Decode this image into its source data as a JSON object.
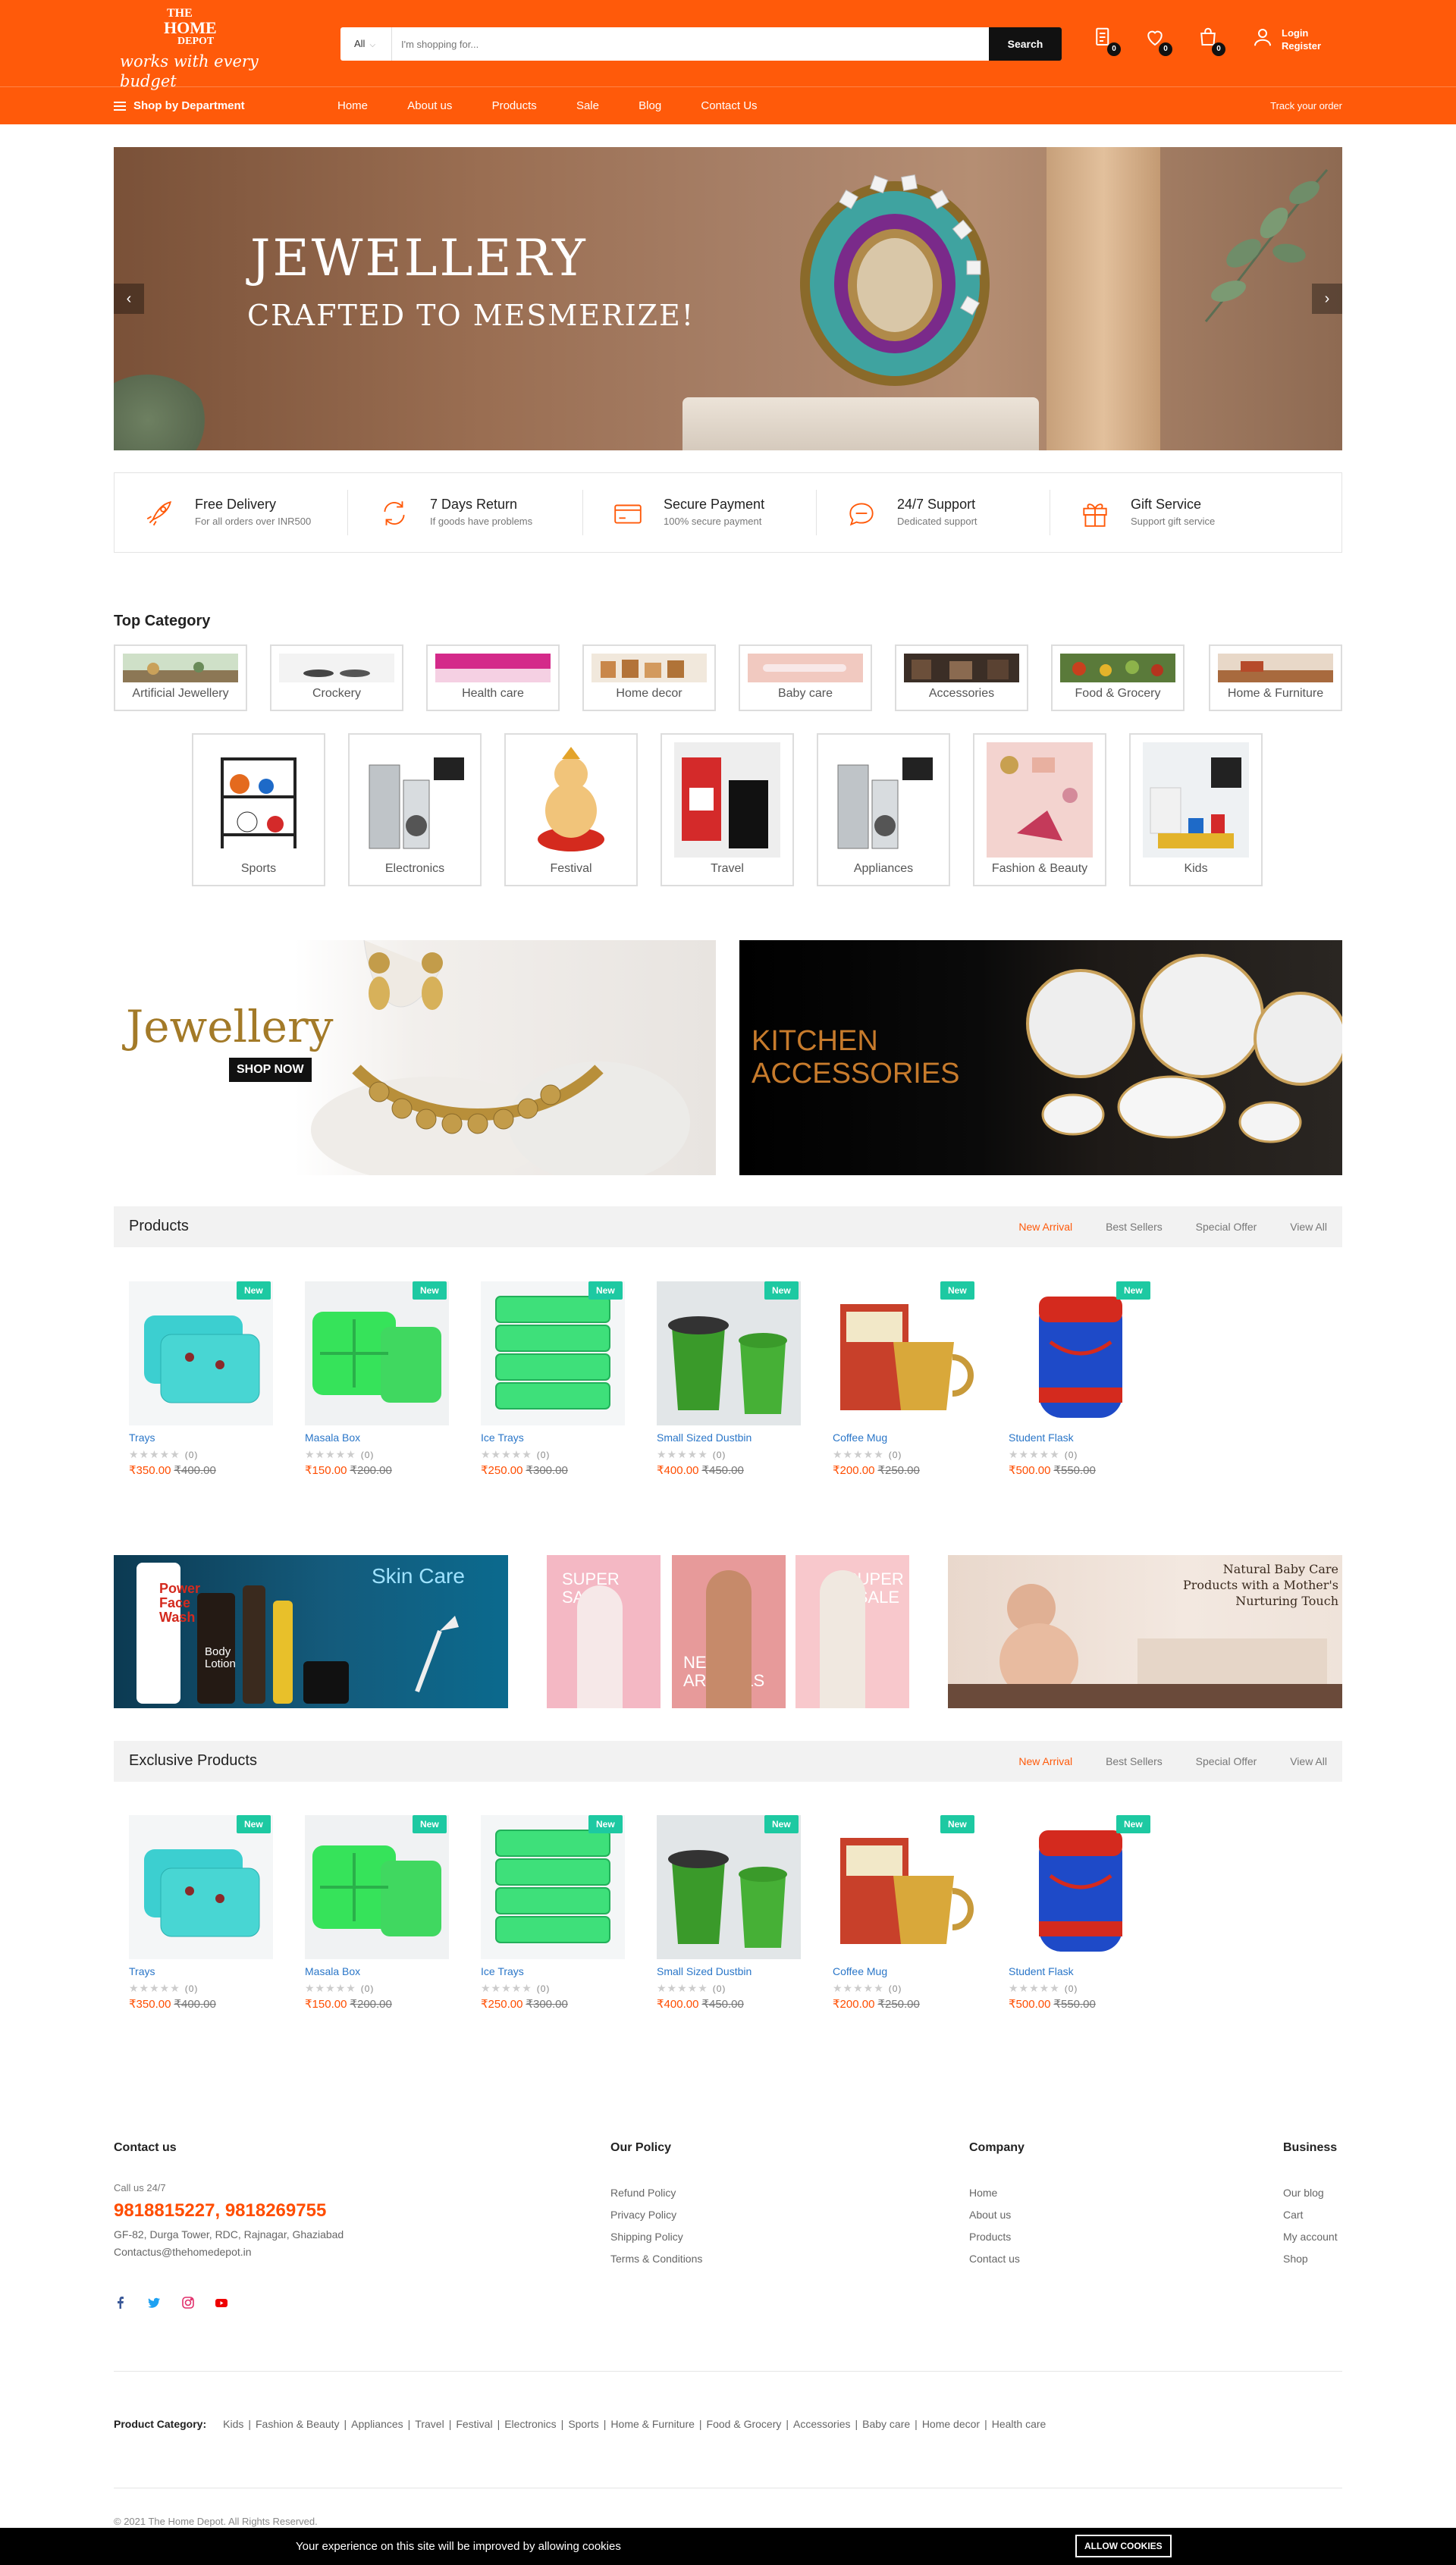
{
  "brand": {
    "l1": "THE",
    "l2": "HOME",
    "l3": "DEPOT",
    "tagline": "works with every budget"
  },
  "search": {
    "category": "All",
    "placeholder": "I'm shopping for...",
    "button": "Search"
  },
  "header_badges": {
    "compare": "0",
    "wishlist": "0",
    "cart": "0"
  },
  "account": {
    "login": "Login",
    "register": "Register"
  },
  "nav": {
    "department": "Shop by Department",
    "items": [
      "Home",
      "About us",
      "Products",
      "Sale",
      "Blog",
      "Contact Us"
    ],
    "track": "Track your order"
  },
  "slider": {
    "title": "JEWELLERY",
    "subtitle": "CRAFTED TO MESMERIZE!",
    "prev": "‹",
    "next": "›"
  },
  "features": [
    {
      "icon": "rocket-icon",
      "title": "Free Delivery",
      "sub": "For all orders over INR500"
    },
    {
      "icon": "return-icon",
      "title": "7 Days Return",
      "sub": "If goods have problems"
    },
    {
      "icon": "card-icon",
      "title": "Secure Payment",
      "sub": "100% secure payment"
    },
    {
      "icon": "chat-icon",
      "title": "24/7 Support",
      "sub": "Dedicated support"
    },
    {
      "icon": "gift-icon",
      "title": "Gift Service",
      "sub": "Support gift service"
    }
  ],
  "top_category": {
    "title": "Top Category",
    "row1": [
      "Artificial Jewellery",
      "Crockery",
      "Health care",
      "Home decor",
      "Baby care",
      "Accessories",
      "Food & Grocery",
      "Home & Furniture"
    ],
    "row2": [
      "Sports",
      "Electronics",
      "Festival",
      "Travel",
      "Appliances",
      "Fashion & Beauty",
      "Kids"
    ]
  },
  "banners": {
    "jewellery": "Jewellery",
    "shop_now": "SHOP NOW",
    "kitchen_1": "KITCHEN",
    "kitchen_2": "ACCESSORIES"
  },
  "products_section": {
    "title": "Products",
    "tabs": [
      "New Arrival",
      "Best Sellers",
      "Special Offer",
      "View All"
    ]
  },
  "exclusive_section": {
    "title": "Exclusive Products",
    "tabs": [
      "New Arrival",
      "Best Sellers",
      "Special Offer",
      "View All"
    ]
  },
  "products": [
    {
      "name": "Trays",
      "price": "₹350.00",
      "old": "₹400.00",
      "badge": "New",
      "reviews": "(0)",
      "stars": "★★★★★"
    },
    {
      "name": "Masala Box",
      "price": "₹150.00",
      "old": "₹200.00",
      "badge": "New",
      "reviews": "(0)",
      "stars": "★★★★★"
    },
    {
      "name": "Ice Trays",
      "price": "₹250.00",
      "old": "₹300.00",
      "badge": "New",
      "reviews": "(0)",
      "stars": "★★★★★"
    },
    {
      "name": "Small Sized Dustbin",
      "price": "₹400.00",
      "old": "₹450.00",
      "badge": "New",
      "reviews": "(0)",
      "stars": "★★★★★"
    },
    {
      "name": "Coffee Mug",
      "price": "₹200.00",
      "old": "₹250.00",
      "badge": "New",
      "reviews": "(0)",
      "stars": "★★★★★"
    },
    {
      "name": "Student Flask",
      "price": "₹500.00",
      "old": "₹550.00",
      "badge": "New",
      "reviews": "(0)",
      "stars": "★★★★★"
    }
  ],
  "promos": {
    "skin": "Skin Care",
    "power": "Power",
    "face_wash": "Face Wash",
    "body_lotion": "Body Lotion",
    "super_sale": "SUPER SALE",
    "new_arrivals": "NEW ARRIVALS",
    "baby": "Natural Baby Care Products with a Mother's Nurturing Touch"
  },
  "footer": {
    "contact_title": "Contact us",
    "call": "Call us 24/7",
    "phone": "9818815227, 9818269755",
    "address": "GF-82, Durga Tower, RDC, Rajnagar, Ghaziabad",
    "email": "Contactus@thehomedepot.in",
    "policy_title": "Our Policy",
    "policy": [
      "Refund Policy",
      "Privacy Policy",
      "Shipping Policy",
      "Terms & Conditions"
    ],
    "company_title": "Company",
    "company": [
      "Home",
      "About us",
      "Products",
      "Contact us"
    ],
    "business_title": "Business",
    "business": [
      "Our blog",
      "Cart",
      "My account",
      "Shop"
    ],
    "product_category_label": "Product Category:",
    "product_categories": [
      "Kids",
      "Fashion & Beauty",
      "Appliances",
      "Travel",
      "Festival",
      "Electronics",
      "Sports",
      "Home & Furniture",
      "Food & Grocery",
      "Accessories",
      "Baby care",
      "Home decor",
      "Health care"
    ],
    "copyright": "© 2021 The Home Depot. All Rights Reserved."
  },
  "cookie": {
    "message": "Your experience on this site will be improved by allowing cookies",
    "button": "ALLOW COOKIES"
  },
  "colors": {
    "brand": "#ff5a0a",
    "badge_new": "#1dc9a2",
    "price": "#ff4d00",
    "link": "#2a76c8"
  }
}
